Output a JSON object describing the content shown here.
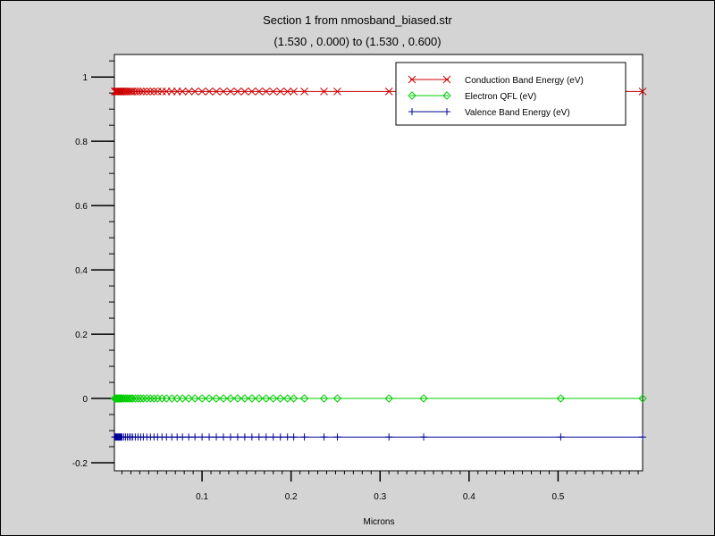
{
  "window": {
    "background": "#d4d4d4",
    "border_color": "#000000"
  },
  "chart_data": {
    "type": "line",
    "title": "Section 1 from nmosband_biased.str",
    "subtitle": "(1.530 , 0.000) to (1.530 , 0.600)",
    "xlabel": "Microns",
    "ylabel": "",
    "xlim": [
      0.0015,
      0.595
    ],
    "ylim": [
      -0.225,
      1.07
    ],
    "x_ticks": [
      {
        "value": 0.1,
        "label": "0.1"
      },
      {
        "value": 0.2,
        "label": "0.2"
      },
      {
        "value": 0.3,
        "label": "0.3"
      },
      {
        "value": 0.4,
        "label": "0.4"
      },
      {
        "value": 0.5,
        "label": "0.5"
      }
    ],
    "y_ticks": [
      {
        "value": -0.2,
        "label": "-0.2"
      },
      {
        "value": 0,
        "label": "0"
      },
      {
        "value": 0.2,
        "label": "0.2"
      },
      {
        "value": 0.4,
        "label": "0.4"
      },
      {
        "value": 0.6,
        "label": "0.6"
      },
      {
        "value": 0.8,
        "label": "0.8"
      },
      {
        "value": 1,
        "label": "1"
      }
    ],
    "y_minor_step": 0.05,
    "x_minor_step": 0.01,
    "grid": false,
    "legend_position": "top-right",
    "x": [
      0.002,
      0.003,
      0.004,
      0.005,
      0.006,
      0.007,
      0.008,
      0.009,
      0.01,
      0.012,
      0.014,
      0.016,
      0.018,
      0.02,
      0.022,
      0.025,
      0.028,
      0.031,
      0.034,
      0.038,
      0.042,
      0.046,
      0.05,
      0.055,
      0.06,
      0.066,
      0.072,
      0.078,
      0.085,
      0.092,
      0.1,
      0.108,
      0.116,
      0.124,
      0.132,
      0.14,
      0.148,
      0.156,
      0.164,
      0.172,
      0.18,
      0.188,
      0.196,
      0.203,
      0.215,
      0.237,
      0.252,
      0.31,
      0.349,
      0.503,
      0.595
    ],
    "series": [
      {
        "name": "Conduction Band Energy (eV)",
        "color": "#cc0000",
        "marker": "x",
        "y_constant": 0.955
      },
      {
        "name": "Electron QFL (eV)",
        "color": "#00cc00",
        "marker": "diamond",
        "y_constant": 0.0
      },
      {
        "name": "Valence Band Energy (eV)",
        "color": "#000099",
        "marker": "plus",
        "y_constant": -0.12
      }
    ]
  }
}
